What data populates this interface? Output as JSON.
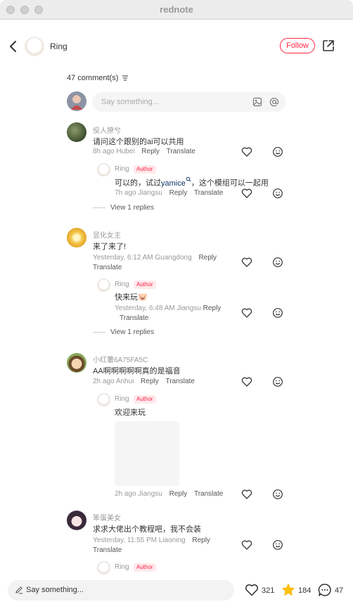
{
  "window": {
    "title": "rednote"
  },
  "header": {
    "author_name": "Ring",
    "follow_label": "Follow"
  },
  "comments_header": {
    "count_label": "47 comment(s)"
  },
  "compose": {
    "placeholder": "Say something..."
  },
  "author_badge": "Author",
  "comments": [
    {
      "user": "伇人撩兮",
      "text": "请问这个跟别的ai可以共用",
      "meta": "8h ago Hubei",
      "reply_label": "Reply",
      "translate_label": "Translate",
      "reply": {
        "user": "Ring",
        "text_before": "可以的，试过",
        "mention": "yamice",
        "text_after": "，这个模组可以一起用",
        "meta": "7h ago Jiangsu",
        "reply_label": "Reply",
        "translate_label": "Translate"
      },
      "view_replies": "View 1 replies"
    },
    {
      "user": "昱化女主",
      "text": "来了来了!",
      "meta": "Yesterday, 6:12 AM Guangdong",
      "reply_label": "Reply",
      "translate_label": "Translate",
      "reply": {
        "user": "Ring",
        "text": "快来玩🐷",
        "meta": "Yesterday, 6:48 AM Jiangsu",
        "reply_label": "Reply",
        "translate_label": "Translate"
      },
      "view_replies": "View 1 replies"
    },
    {
      "user": "小红薯6A75FA5C",
      "text": "AA啊啊啊啊啊真的是福音",
      "meta": "2h ago Anhui",
      "reply_label": "Reply",
      "translate_label": "Translate",
      "reply": {
        "user": "Ring",
        "text": "欢迎来玩",
        "meta": "2h ago Jiangsu",
        "reply_label": "Reply",
        "translate_label": "Translate"
      }
    },
    {
      "user": "笨蛋美女",
      "text": "求求大佬出个教程吧，我不会装",
      "meta": "Yesterday, 11:55 PM Liaoning",
      "reply_label": "Reply",
      "translate_label": "Translate",
      "reply": {
        "user": "Ring"
      }
    }
  ],
  "bottom_bar": {
    "placeholder": "Say something...",
    "likes": "321",
    "collects": "184",
    "comments": "47"
  },
  "colors": {
    "accent": "#ff2442",
    "mention": "#13386c",
    "star": "#ffc107"
  },
  "icons": [
    "back-icon",
    "share-icon",
    "sort-icon",
    "image-icon",
    "at-icon",
    "heart-icon",
    "emoji-icon",
    "pen-icon",
    "star-icon",
    "chat-icon"
  ]
}
